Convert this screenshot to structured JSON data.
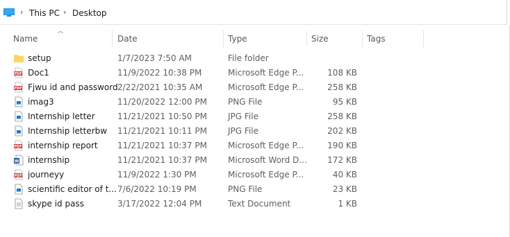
{
  "breadcrumb": {
    "items": [
      "This PC",
      "Desktop"
    ]
  },
  "columns": {
    "name": "Name",
    "date": "Date",
    "type": "Type",
    "size": "Size",
    "tags": "Tags"
  },
  "files": [
    {
      "name": "setup",
      "date": "1/7/2023 7:50 AM",
      "type": "File folder",
      "size": "",
      "icon": "folder-icon"
    },
    {
      "name": "Doc1",
      "date": "11/9/2022 10:38 PM",
      "type": "Microsoft Edge P...",
      "size": "108 KB",
      "icon": "pdf-icon"
    },
    {
      "name": "Fjwu id and password",
      "date": "2/22/2021 10:35 AM",
      "type": "Microsoft Edge P...",
      "size": "258 KB",
      "icon": "pdf-icon"
    },
    {
      "name": "imag3",
      "date": "11/20/2022 12:00 PM",
      "type": "PNG File",
      "size": "95 KB",
      "icon": "image-file-icon"
    },
    {
      "name": "Internship letter",
      "date": "11/21/2021 10:50 PM",
      "type": "JPG File",
      "size": "258 KB",
      "icon": "image-file-icon"
    },
    {
      "name": "Internship letterbw",
      "date": "11/21/2021 10:11 PM",
      "type": "JPG File",
      "size": "202 KB",
      "icon": "image-file-icon"
    },
    {
      "name": "internship report",
      "date": "11/21/2021 10:37 PM",
      "type": "Microsoft Edge P...",
      "size": "190 KB",
      "icon": "pdf-icon"
    },
    {
      "name": "internship",
      "date": "11/21/2021 10:37 PM",
      "type": "Microsoft Word D...",
      "size": "172 KB",
      "icon": "word-doc-icon"
    },
    {
      "name": "journeyy",
      "date": "11/9/2022 1:30 PM",
      "type": "Microsoft Edge P...",
      "size": "40 KB",
      "icon": "pdf-icon"
    },
    {
      "name": "scientific editor of t...",
      "date": "7/6/2022 10:19 PM",
      "type": "PNG File",
      "size": "23 KB",
      "icon": "image-file-icon"
    },
    {
      "name": "skype id pass",
      "date": "3/17/2022 12:04 PM",
      "type": "Text Document",
      "size": "1 KB",
      "icon": "text-file-icon"
    }
  ]
}
